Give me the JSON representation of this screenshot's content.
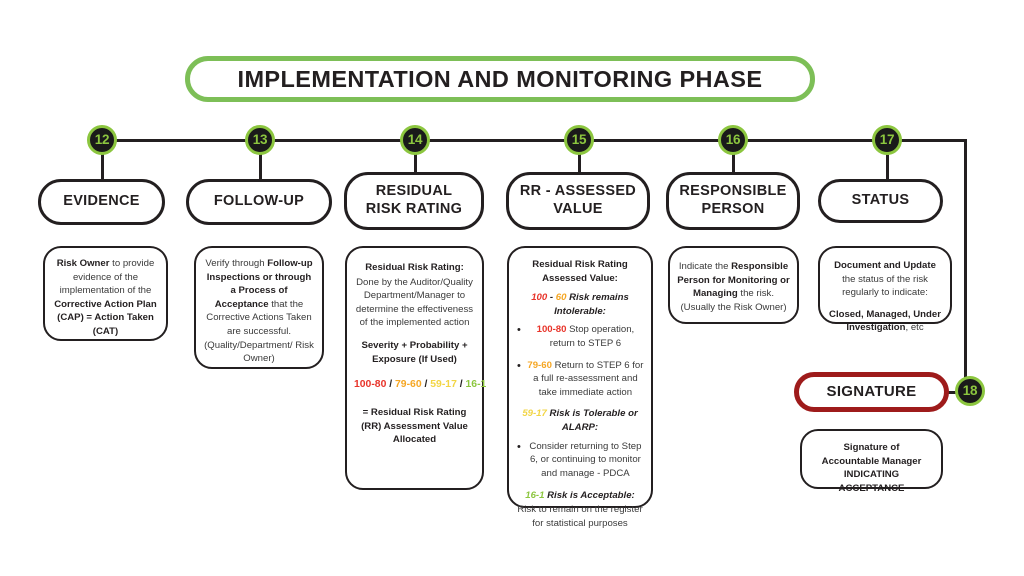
{
  "title": "IMPLEMENTATION AND MONITORING PHASE",
  "colors": {
    "green": "#8CC63F",
    "title_green": "#7DBF57",
    "dark": "#231f20",
    "signature_red": "#9E1B1B",
    "range_red": "#E8342A",
    "range_orange": "#F5A623",
    "range_yellow": "#F2D545",
    "range_green": "#8CC63F"
  },
  "steps": [
    {
      "number": "12",
      "header": "EVIDENCE"
    },
    {
      "number": "13",
      "header": "FOLLOW-UP"
    },
    {
      "number": "14",
      "header_line1": "RESIDUAL",
      "header_line2": "RISK RATING"
    },
    {
      "number": "15",
      "header_line1": "RR - ASSESSED",
      "header_line2": "VALUE"
    },
    {
      "number": "16",
      "header_line1": "RESPONSIBLE",
      "header_line2": "PERSON"
    },
    {
      "number": "17",
      "header": "STATUS"
    },
    {
      "number": "18",
      "header": "SIGNATURE"
    }
  ],
  "card12": {
    "b1": "Risk Owner",
    "t1": " to provide evidence of the implementation of the ",
    "b2": "Corrective Action Plan (CAP) = Action Taken (CAT)"
  },
  "card13": {
    "t1": "Verify through ",
    "b1": "Follow-up Inspections or through a Process of Acceptance",
    "t2": " that the Corrective Actions Taken are successful. (Quality/Department/ Risk Owner)"
  },
  "card14": {
    "heading": "Residual Risk Rating:",
    "body": "Done by the Auditor/Quality Department/Manager to determine the effectiveness of the implemented action",
    "formula": "Severity + Probability + Exposure (If Used)",
    "ranges": [
      {
        "label": "100-80",
        "color": "red"
      },
      {
        "label": "79-60",
        "color": "orange"
      },
      {
        "label": "59-17",
        "color": "yellow"
      },
      {
        "label": "16-1",
        "color": "green"
      }
    ],
    "range_separator": " / ",
    "result": "= Residual Risk Rating (RR) Assessment Value Allocated"
  },
  "card15": {
    "heading": "Residual Risk Rating Assessed Value:",
    "intolerable_range_high": "100",
    "intolerable_dash": " - ",
    "intolerable_range_low": "60",
    "intolerable_text": " Risk remains Intolerable:",
    "bullet1_range": "100-80",
    "bullet1_text": " Stop operation, return to STEP 6",
    "bullet2_range": "79-60",
    "bullet2_text": " Return to STEP 6 for a full re-assessment and take immediate action",
    "tolerable_range": "59-17",
    "tolerable_text": " Risk is Tolerable  or ALARP:",
    "bullet3_text": "Consider returning to Step 6, or continuing to monitor and manage - PDCA",
    "acceptable_range": "16-1",
    "acceptable_text": " Risk is Acceptable:",
    "acceptable_body": "Risk to remain on the register for statistical purposes"
  },
  "card16": {
    "t1": "Indicate the ",
    "b1": "Responsible Person for Monitoring or Managing",
    "t2": " the risk. (Usually the Risk Owner)"
  },
  "card17": {
    "b1": "Document and Update",
    "t1": " the status of the risk regularly to indicate:",
    "b2": "Closed, Managed, Under Investigation",
    "t2": ", etc"
  },
  "card18": {
    "line1": "Signature of",
    "line2": "Accountable Manager",
    "line3": "INDICATING",
    "line4": "ACCEPTANCE"
  }
}
